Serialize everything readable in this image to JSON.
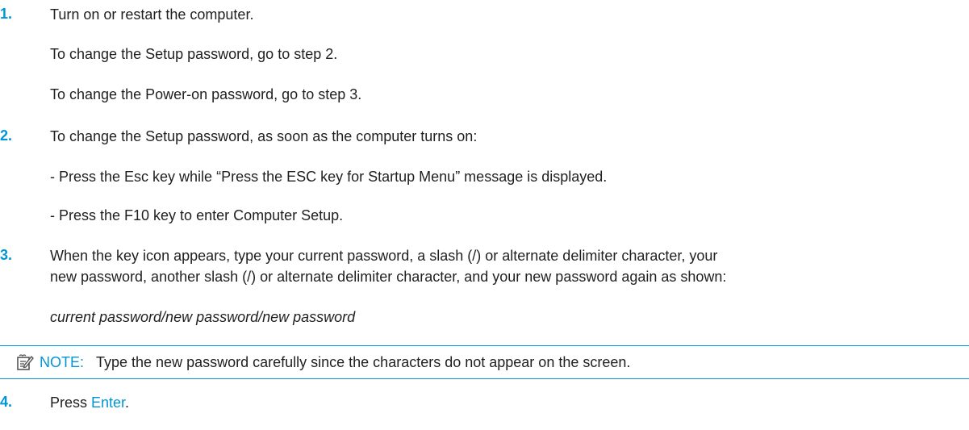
{
  "steps": [
    {
      "number": "1.",
      "text": "Turn on or restart the computer."
    },
    {
      "number": "2.",
      "text": "To change the Setup password, as soon as the computer turns on:"
    },
    {
      "number": "3.",
      "line1": "When the key icon appears, type your current password, a slash (/) or alternate delimiter character, your",
      "line2": "new password, another slash (/) or alternate delimiter character, and your new password again as shown:"
    },
    {
      "number": "4.",
      "prefix": "Press ",
      "link": "Enter",
      "suffix": "."
    }
  ],
  "step1_sub": [
    "To change the Setup password, go to step 2.",
    "To change the Power-on password, go to step 3."
  ],
  "step2_sub": [
    "- Press the Esc key while “Press the ESC key for Startup Menu” message is displayed.",
    "- Press the F10 key to enter Computer Setup."
  ],
  "step3_example": "current password/new password/new password",
  "note": {
    "label": "NOTE:",
    "text": "Type the new password carefully since the characters do not appear on the screen.",
    "icon": "note-pencil-icon"
  },
  "colors": {
    "accent": "#0096d6",
    "text": "#1f1f1f"
  }
}
